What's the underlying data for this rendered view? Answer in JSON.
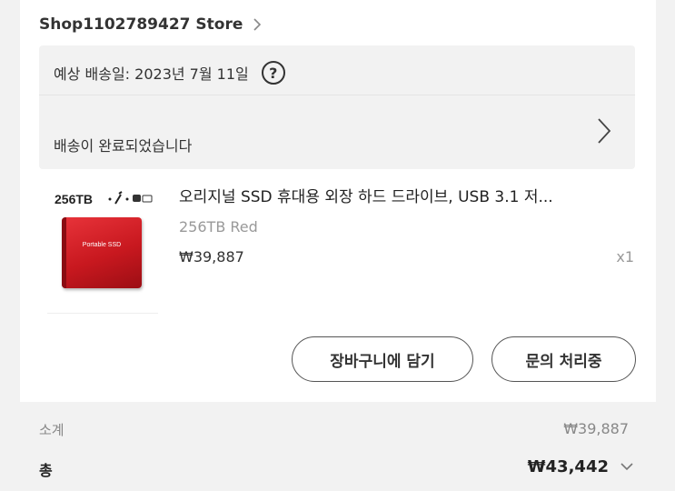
{
  "store": {
    "name": "Shop1102789427 Store",
    "chevron_icon": "chevron-right-icon"
  },
  "shipping": {
    "estimated_date": "예상 배송일: 2023년 7월 11일",
    "help_symbol": "?",
    "status": "배송이 완료되었습니다"
  },
  "product": {
    "thumbnail_label": "256TB",
    "thumbnail_case_text": "Portable SSD",
    "title": "오리지널 SSD 휴대용 외장 하드 드라이브, USB 3.1 저...",
    "variant": "256TB Red",
    "price": "₩39,887",
    "quantity": "x1",
    "color": "#d1232a"
  },
  "actions": {
    "add_to_cart": "장바구니에 담기",
    "inquiry": "문의 처리중"
  },
  "summary": {
    "subtotal_label": "소계",
    "subtotal_value": "₩39,887",
    "total_label": "총",
    "total_value": "₩43,442"
  },
  "colors": {
    "background": "#f2f2f2",
    "card": "#ffffff",
    "muted": "#999999"
  }
}
